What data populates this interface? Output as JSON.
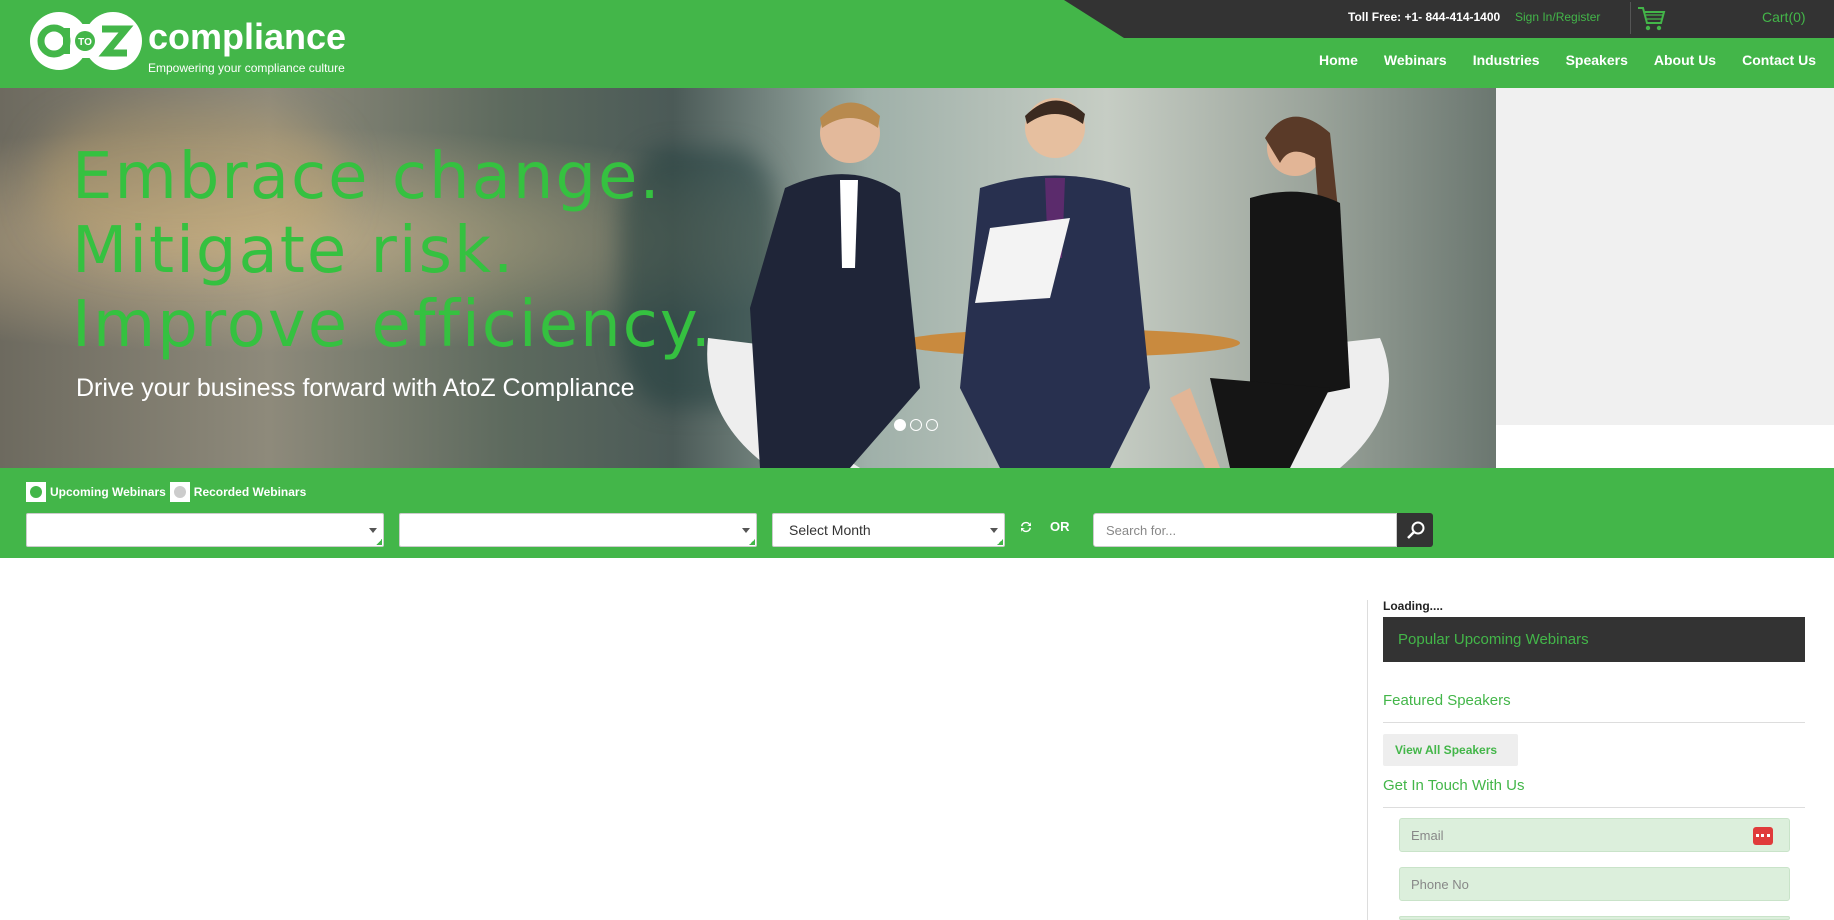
{
  "header": {
    "logo_name": "compliance",
    "logo_tagline": "Empowering your compliance culture",
    "logo_mark_text": "TO",
    "toll_free": "Toll Free: +1- 844-414-1400",
    "signin": "Sign In/Register",
    "cart": "Cart(0)",
    "nav": [
      "Home",
      "Webinars",
      "Industries",
      "Speakers",
      "About Us",
      "Contact Us"
    ]
  },
  "hero": {
    "line1": "Embrace change.",
    "line2": "Mitigate risk.",
    "line3": "Improve efficiency.",
    "subtitle": "Drive your business forward with AtoZ Compliance",
    "slides": 3,
    "active_slide": 1
  },
  "filters": {
    "radio_upcoming": "Upcoming Webinars",
    "radio_recorded": "Recorded Webinars",
    "select1_value": "",
    "select2_value": "",
    "month_value": "Select Month",
    "or_label": "OR",
    "search_placeholder": "Search for..."
  },
  "sidebar": {
    "loading": "Loading....",
    "popular_title": "Popular Upcoming Webinars",
    "featured_title": "Featured Speakers",
    "view_all": "View All Speakers",
    "contact_title": "Get In Touch With Us",
    "email_placeholder": "Email",
    "phone_placeholder": "Phone No"
  },
  "colors": {
    "brand_green": "#43b649",
    "dark": "#333333",
    "field_bg": "#dcefdc"
  }
}
